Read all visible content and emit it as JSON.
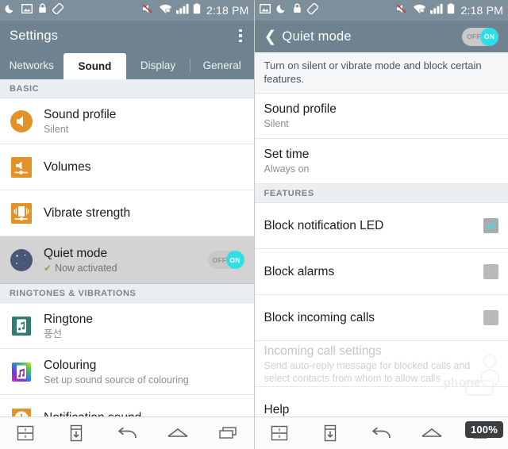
{
  "left": {
    "statusbar": {
      "icons": [
        "moon-icon",
        "image-icon",
        "lock-icon",
        "rotation-lock-icon"
      ],
      "right_icons": [
        "mute-icon",
        "wifi-secure-icon",
        "signal-icon",
        "battery-icon"
      ],
      "time": "2:18 PM"
    },
    "appbar": {
      "title": "Settings",
      "menu": "overflow-menu-icon"
    },
    "tabs": [
      {
        "label": "Networks",
        "active": false
      },
      {
        "label": "Sound",
        "active": true
      },
      {
        "label": "Display",
        "active": false
      },
      {
        "label": "General",
        "active": false
      }
    ],
    "sections": [
      {
        "header": "BASIC"
      },
      {
        "header": "RINGTONES & VIBRATIONS"
      }
    ],
    "items": [
      {
        "title": "Sound profile",
        "subtitle": "Silent",
        "icon": "sound-profile-icon"
      },
      {
        "title": "Volumes",
        "subtitle": "",
        "icon": "volumes-icon"
      },
      {
        "title": "Vibrate strength",
        "subtitle": "",
        "icon": "vibrate-strength-icon"
      },
      {
        "title": "Quiet mode",
        "subtitle": "Now activated",
        "icon": "quiet-mode-icon",
        "toggle_off": "OFF",
        "toggle_on": "ON"
      },
      {
        "title": "Ringtone",
        "subtitle": "풍선",
        "icon": "ringtone-icon"
      },
      {
        "title": "Colouring",
        "subtitle": "Set up sound source of colouring",
        "icon": "colouring-icon"
      },
      {
        "title": "Notification sound",
        "subtitle": "",
        "icon": "notification-sound-icon"
      }
    ]
  },
  "right": {
    "statusbar": {
      "icons": [
        "image-icon",
        "moon-icon",
        "lock-icon",
        "rotation-lock-icon"
      ],
      "right_icons": [
        "mute-icon",
        "wifi-secure-icon",
        "signal-icon",
        "battery-icon"
      ],
      "time": "2:18 PM"
    },
    "appbar": {
      "title": "Quiet mode",
      "back": "back-chevron-icon",
      "toggle_off": "OFF",
      "toggle_on": "ON"
    },
    "description": "Turn on silent or vibrate mode and block certain features.",
    "section_header": "FEATURES",
    "items": [
      {
        "title": "Sound profile",
        "subtitle": "Silent",
        "type": "nav"
      },
      {
        "title": "Set time",
        "subtitle": "Always on",
        "type": "nav"
      },
      {
        "title": "Block notification LED",
        "subtitle": "",
        "type": "checkbox",
        "checked": true
      },
      {
        "title": "Block alarms",
        "subtitle": "",
        "type": "checkbox",
        "checked": false
      },
      {
        "title": "Block incoming calls",
        "subtitle": "",
        "type": "checkbox",
        "checked": false
      },
      {
        "title": "Incoming call settings",
        "subtitle": "Send auto-reply message for blocked calls and select contacts from whom to allow calls",
        "type": "disabled"
      },
      {
        "title": "Help",
        "subtitle": "",
        "type": "nav"
      }
    ]
  },
  "navbar": {
    "buttons": [
      "dual-window-icon",
      "capture-plus-icon",
      "back-icon",
      "home-icon",
      "recent-apps-icon"
    ]
  },
  "overlay": {
    "zoom_badge": "100%",
    "watermark": "phone"
  },
  "colors": {
    "appbar": "#6e828f",
    "statusbar": "#7d8f9b",
    "accent_cyan": "#2fdfe8",
    "icon_orange": "#e29227",
    "check_green": "#7cb342"
  }
}
